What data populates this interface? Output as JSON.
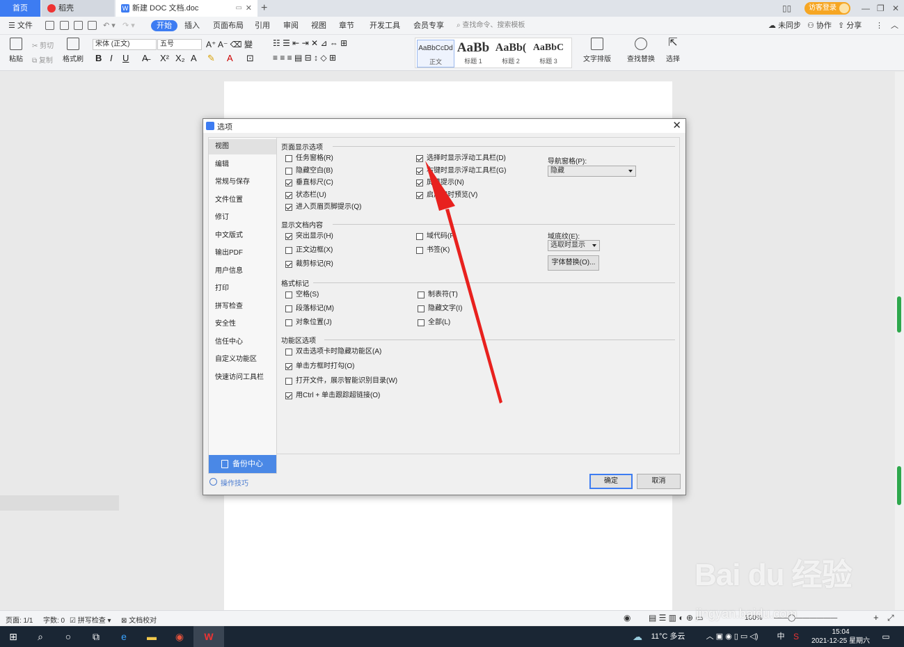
{
  "tabs": {
    "home": "首页",
    "daoke": "稻壳",
    "doc": "新建 DOC 文档.doc"
  },
  "visitor_login": "访客登录",
  "menu": {
    "file": "文件",
    "items": [
      "开始",
      "插入",
      "页面布局",
      "引用",
      "审阅",
      "视图",
      "章节",
      "开发工具",
      "会员专享"
    ],
    "search": "查找命令、搜索模板",
    "right": [
      "未同步",
      "协作",
      "分享"
    ]
  },
  "ribbon": {
    "paste": "粘贴",
    "cut": "剪切",
    "copy": "复制",
    "format_painter": "格式刷",
    "font_name": "宋体 (正文)",
    "font_size": "五号",
    "styles": [
      {
        "preview": "AaBbCcDd",
        "name": "正文"
      },
      {
        "preview": "AaBb",
        "name": "标题 1"
      },
      {
        "preview": "AaBb(",
        "name": "标题 2"
      },
      {
        "preview": "AaBbC",
        "name": "标题 3"
      }
    ],
    "text_layout": "文字排版",
    "find_replace": "查找替换",
    "select": "选择"
  },
  "dialog": {
    "title": "选项",
    "nav": [
      "视图",
      "编辑",
      "常规与保存",
      "文件位置",
      "修订",
      "中文版式",
      "输出PDF",
      "用户信息",
      "打印",
      "拼写检查",
      "安全性",
      "信任中心",
      "自定义功能区",
      "快速访问工具栏"
    ],
    "backup": "备份中心",
    "tips": "操作技巧",
    "sections": {
      "page_display": "页面显示选项",
      "doc_content": "显示文档内容",
      "format_marks": "格式标记",
      "ribbon_options": "功能区选项"
    },
    "page_display_left": [
      {
        "label": "任务窗格(R)",
        "checked": false
      },
      {
        "label": "隐藏空白(B)",
        "checked": false
      },
      {
        "label": "垂直标尺(C)",
        "checked": true
      },
      {
        "label": "状态栏(U)",
        "checked": true
      },
      {
        "label": "进入页眉页脚提示(Q)",
        "checked": true
      }
    ],
    "page_display_mid": [
      {
        "label": "选择时显示浮动工具栏(D)",
        "checked": true
      },
      {
        "label": "右键时显示浮动工具栏(G)",
        "checked": true
      },
      {
        "label": "屏幕提示(N)",
        "checked": true
      },
      {
        "label": "启用实时预览(V)",
        "checked": true
      }
    ],
    "nav_pane_label": "导航窗格(P):",
    "nav_pane_value": "隐藏",
    "doc_content_left": [
      {
        "label": "突出显示(H)",
        "checked": true
      },
      {
        "label": "正文边框(X)",
        "checked": false
      },
      {
        "label": "裁剪标记(R)",
        "checked": true
      }
    ],
    "doc_content_mid": [
      {
        "label": "域代码(F)",
        "checked": false
      },
      {
        "label": "书签(K)",
        "checked": false
      }
    ],
    "field_shading_label": "域底纹(E):",
    "field_shading_value": "选取时显示",
    "font_substitution": "字体替换(O)...",
    "format_marks_left": [
      {
        "label": "空格(S)",
        "checked": false
      },
      {
        "label": "段落标记(M)",
        "checked": false
      },
      {
        "label": "对象位置(J)",
        "checked": false
      }
    ],
    "format_marks_mid": [
      {
        "label": "制表符(T)",
        "checked": false
      },
      {
        "label": "隐藏文字(I)",
        "checked": false
      },
      {
        "label": "全部(L)",
        "checked": false
      }
    ],
    "ribbon_opts": [
      {
        "label": "双击选项卡时隐藏功能区(A)",
        "checked": false
      },
      {
        "label": "单击方框时打勾(O)",
        "checked": true
      },
      {
        "label": "打开文件，展示智能识别目录(W)",
        "checked": false
      },
      {
        "label": "用Ctrl + 单击跟踪超链接(O)",
        "checked": true
      }
    ],
    "ok": "确定",
    "cancel": "取消"
  },
  "status": {
    "page": "页面: 1/1",
    "words": "字数: 0",
    "spell": "拼写检查",
    "proof": "文档校对",
    "zoom": "100%"
  },
  "taskbar": {
    "weather": "11°C 多云",
    "ime": "中",
    "time": "15:04",
    "date": "2021-12-25 星期六"
  },
  "watermark": {
    "brand": "Bai du 经验",
    "url": "jingyan.baidu.com"
  },
  "colors": {
    "accent": "#3d7cf2",
    "arrow": "#e8211e",
    "taskbar": "#1a2634"
  }
}
